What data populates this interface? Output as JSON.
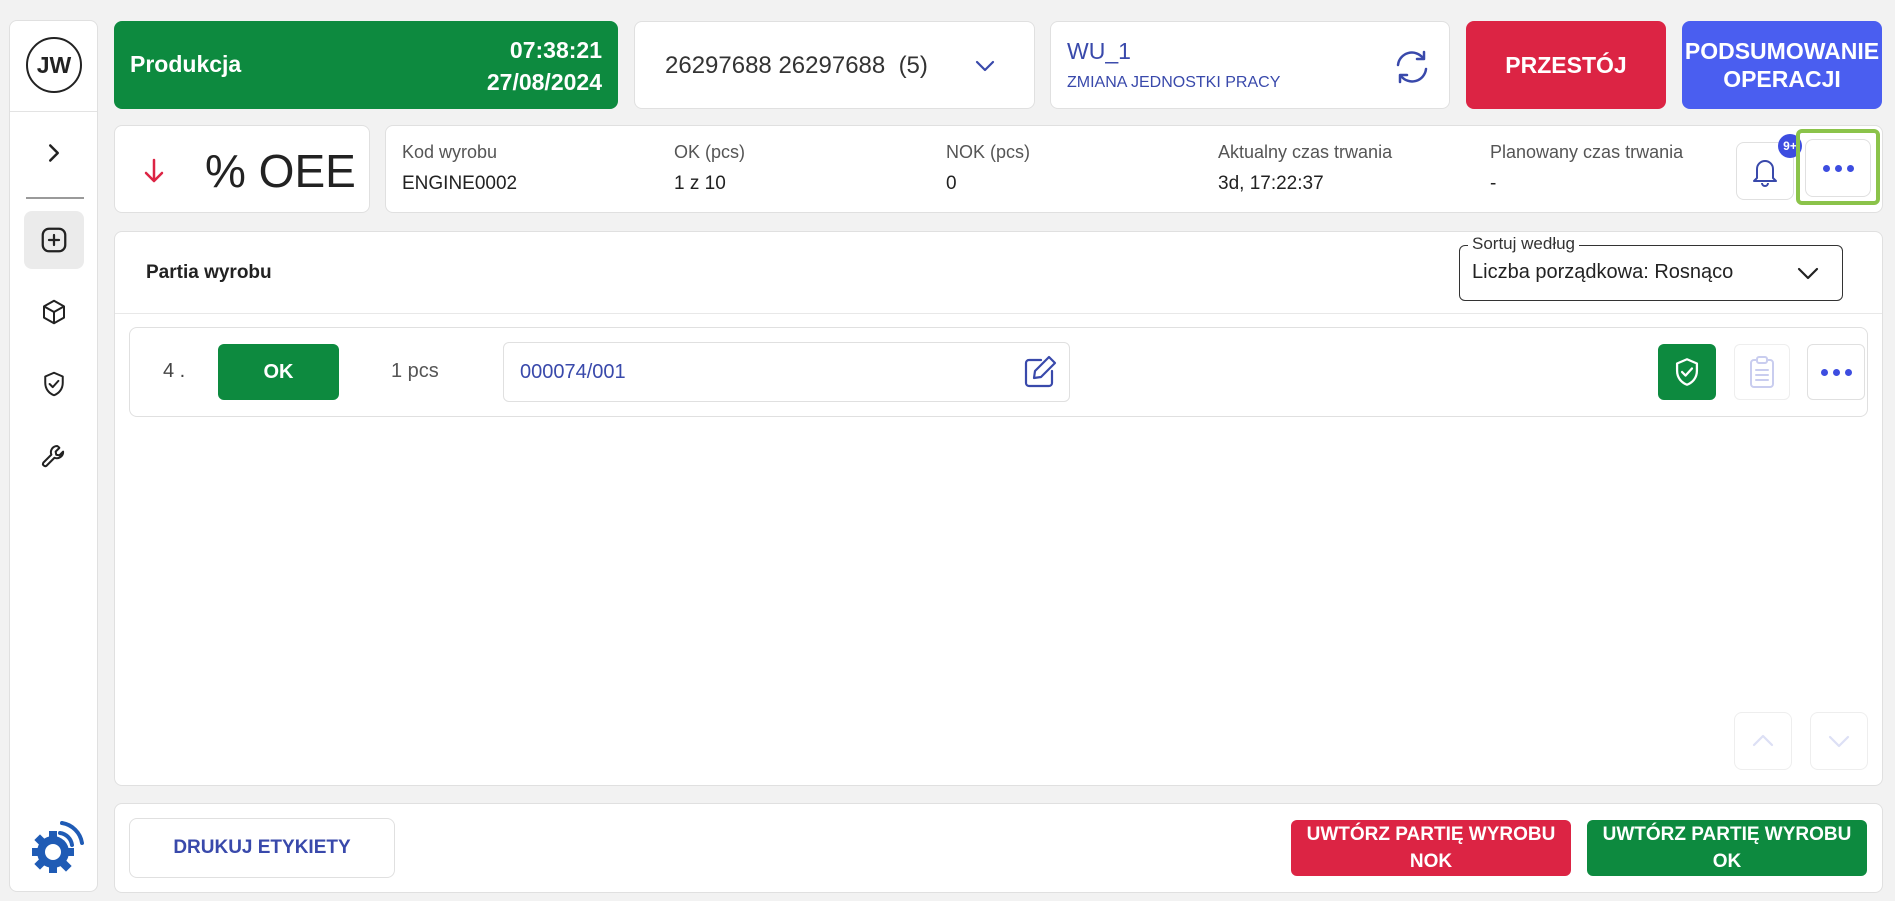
{
  "sidebar": {
    "avatar_initials": "JW",
    "items": [
      {
        "icon": "chevron-right-icon"
      },
      {
        "icon": "plus-square-icon",
        "active": true
      },
      {
        "icon": "cube-icon"
      },
      {
        "icon": "shield-check-icon"
      },
      {
        "icon": "wrench-icon"
      }
    ],
    "logo_icon": "gear-wifi-logo"
  },
  "header": {
    "status_label": "Produkcja",
    "time": "07:38:21",
    "date": "27/08/2024",
    "order_selector": "26297688 26297688  (5)",
    "work_unit": {
      "title": "WU_1",
      "subtitle": "ZMIANA JEDNOSTKI PRACY"
    },
    "downtime_button": "PRZESTÓJ",
    "summary_button_line1": "PODSUMOWANIE",
    "summary_button_line2": "OPERACJI"
  },
  "oee": {
    "label": "% OEE",
    "trend": "down"
  },
  "info": {
    "product_code_label": "Kod wyrobu",
    "product_code": "ENGINE0002",
    "ok_label": "OK (pcs)",
    "ok_value": "1 z 10",
    "nok_label": "NOK (pcs)",
    "nok_value": "0",
    "actual_duration_label": "Aktualny czas trwania",
    "actual_duration": "3d, 17:22:37",
    "planned_duration_label": "Planowany czas trwania",
    "planned_duration": "-",
    "notifications_badge": "9+"
  },
  "main": {
    "title": "Partia wyrobu",
    "sort_label": "Sortuj według",
    "sort_value": "Liczba porządkowa: Rosnąco",
    "rows": [
      {
        "number": "4 .",
        "status": "OK",
        "quantity": "1 pcs",
        "batch": "000074/001"
      }
    ]
  },
  "footer": {
    "print_button": "DRUKUJ ETYKIETY",
    "create_nok_line1": "UWTÓRZ PARTIĘ WYROBU",
    "create_nok_line2": "NOK",
    "create_ok_line1": "UWTÓRZ PARTIĘ WYROBU",
    "create_ok_line2": "OK"
  },
  "colors": {
    "green": "#0d8a3f",
    "red": "#dc2444",
    "blue": "#4a5ef0",
    "link_blue": "#3949ab",
    "highlight": "#8bc34a"
  }
}
